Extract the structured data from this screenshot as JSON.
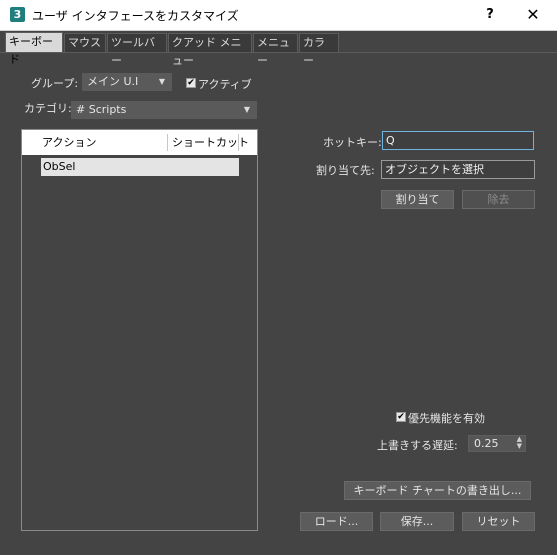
{
  "window": {
    "icon_label": "3",
    "title": "ユーザ インタフェースをカスタマイズ",
    "help_label": "?",
    "close_label": "✕"
  },
  "tabs": [
    {
      "label": "キーボード",
      "active": true
    },
    {
      "label": "マウス"
    },
    {
      "label": "ツールバー"
    },
    {
      "label": "クアッド メニュー"
    },
    {
      "label": "メニュー"
    },
    {
      "label": "カラー"
    }
  ],
  "group": {
    "label": "グループ:",
    "value": "メイン U.I",
    "active_label": "アクティブ",
    "active_checked": true
  },
  "category": {
    "label": "カテゴリ:",
    "value": "# Scripts"
  },
  "actions_list": {
    "columns": [
      "アクション",
      "ショートカット"
    ],
    "rows": [
      {
        "action": "ObSel",
        "shortcut": ""
      }
    ]
  },
  "hotkey": {
    "label": "ホットキー:",
    "value": "Q"
  },
  "assigned_to": {
    "label": "割り当て先:",
    "value": "オブジェクトを選択"
  },
  "buttons": {
    "assign": "割り当て",
    "remove": "除去",
    "export_chart": "キーボード チャートの書き出し...",
    "load": "ロード...",
    "save": "保存...",
    "reset": "リセット"
  },
  "priority": {
    "label": "優先機能を有効",
    "checked": true
  },
  "overwrite_delay": {
    "label": "上書きする遅延:",
    "value": "0.25"
  },
  "icons": {
    "dropdown": "▼",
    "checkmark": "✔",
    "spin_up": "▲",
    "spin_down": "▼"
  }
}
